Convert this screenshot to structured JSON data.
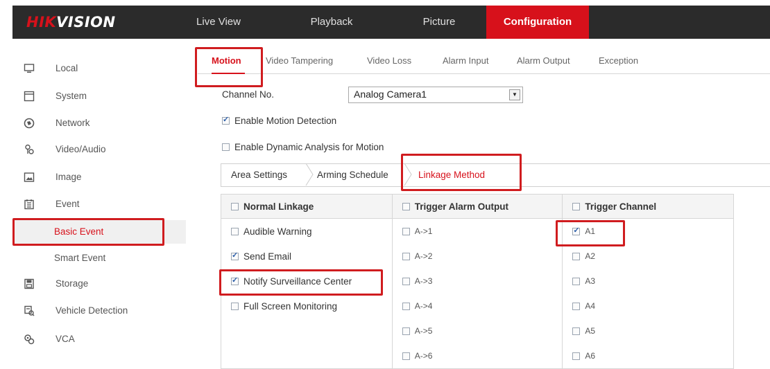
{
  "brand": {
    "logo_red": "HIK",
    "logo_white": "VISION"
  },
  "colors": {
    "accent": "#d7111b",
    "topbar": "#2b2b2b",
    "highlight": "#d01c1f"
  },
  "topnav": {
    "tabs": [
      {
        "label": "Live View"
      },
      {
        "label": "Playback"
      },
      {
        "label": "Picture"
      },
      {
        "label": "Configuration",
        "active": true
      }
    ]
  },
  "sidebar": {
    "items": [
      {
        "label": "Local",
        "icon": "monitor-icon"
      },
      {
        "label": "System",
        "icon": "system-icon"
      },
      {
        "label": "Network",
        "icon": "network-icon"
      },
      {
        "label": "Video/Audio",
        "icon": "video-audio-icon"
      },
      {
        "label": "Image",
        "icon": "image-icon"
      },
      {
        "label": "Event",
        "icon": "event-icon"
      }
    ],
    "event_sub": [
      {
        "label": "Basic Event",
        "active": true
      },
      {
        "label": "Smart Event"
      }
    ],
    "items2": [
      {
        "label": "Storage",
        "icon": "storage-icon"
      },
      {
        "label": "Vehicle Detection",
        "icon": "vehicle-detection-icon"
      },
      {
        "label": "VCA",
        "icon": "vca-icon"
      }
    ]
  },
  "subtabs": [
    {
      "label": "Motion",
      "active": true
    },
    {
      "label": "Video Tampering"
    },
    {
      "label": "Video Loss"
    },
    {
      "label": "Alarm Input"
    },
    {
      "label": "Alarm Output"
    },
    {
      "label": "Exception"
    }
  ],
  "form": {
    "channel_label": "Channel No.",
    "channel_value": "Analog Camera1",
    "enable_motion": {
      "label": "Enable Motion Detection",
      "checked": true
    },
    "enable_dynamic": {
      "label": "Enable Dynamic Analysis for Motion",
      "checked": false
    }
  },
  "crumbs": [
    {
      "label": "Area Settings"
    },
    {
      "label": "Arming Schedule"
    },
    {
      "label": "Linkage Method",
      "active": true
    }
  ],
  "table": {
    "headers": [
      "Normal Linkage",
      "Trigger Alarm Output",
      "Trigger Channel"
    ],
    "col1": [
      {
        "label": "Audible Warning",
        "checked": false
      },
      {
        "label": "Send Email",
        "checked": true
      },
      {
        "label": "Notify Surveillance Center",
        "checked": true
      },
      {
        "label": "Full Screen Monitoring",
        "checked": false
      }
    ],
    "col2": [
      "A->1",
      "A->2",
      "A->3",
      "A->4",
      "A->5",
      "A->6"
    ],
    "col3": [
      {
        "label": "A1",
        "checked": true
      },
      {
        "label": "A2",
        "checked": false
      },
      {
        "label": "A3",
        "checked": false
      },
      {
        "label": "A4",
        "checked": false
      },
      {
        "label": "A5",
        "checked": false
      },
      {
        "label": "A6",
        "checked": false
      }
    ]
  }
}
